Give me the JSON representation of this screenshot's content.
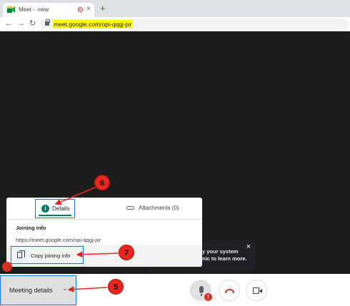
{
  "browser": {
    "tab_title": "Meet - -new",
    "new_tab_symbol": "+",
    "close_symbol": "×",
    "nav": {
      "back": "←",
      "forward": "→",
      "reload": "↻"
    },
    "url": "meet.google.com/opi-qqgj-jxr"
  },
  "details_panel": {
    "tab_details_label": "Details",
    "tab_attachments_label": "Attachments (0)",
    "joining_info_title": "Joining info",
    "joining_link": "https://meet.google.com/opi-qqgj-jxr",
    "copy_button_label": "Copy joining info"
  },
  "tooltip": {
    "text_line1": "y your system",
    "text_line2": "nic to learn more.",
    "close_symbol": "×"
  },
  "bottom_bar": {
    "meeting_details_label": "Meeting details",
    "chevron": "⌄",
    "mic_badge": "!"
  },
  "annotations": {
    "five": "5",
    "six": "6",
    "seven": "7"
  },
  "colors": {
    "annotation_red": "#e8281e",
    "accent_blue": "#1a73e8",
    "teal": "#00796b",
    "url_highlight": "#ffff00"
  }
}
